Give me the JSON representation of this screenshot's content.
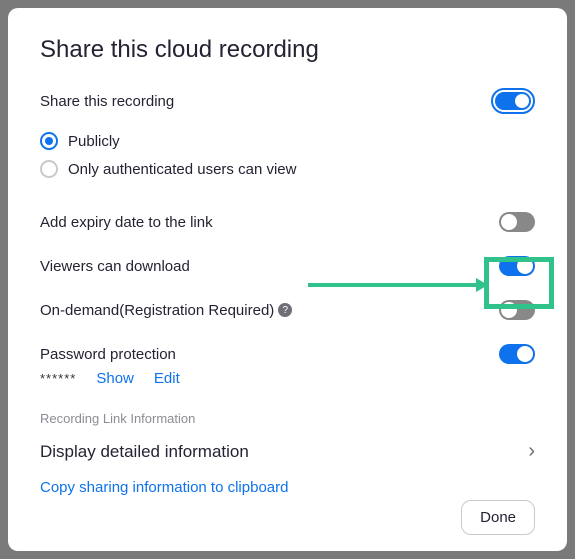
{
  "title": "Share this cloud recording",
  "shareRecording": {
    "label": "Share this recording",
    "options": {
      "publicly": "Publicly",
      "authenticated": "Only authenticated users can view"
    }
  },
  "settings": {
    "expiry": "Add expiry date to the link",
    "download": "Viewers can download",
    "onDemand": "On-demand(Registration Required)",
    "password": "Password protection"
  },
  "password": {
    "masked": "******",
    "show": "Show",
    "edit": "Edit"
  },
  "linkInfo": {
    "header": "Recording Link Information",
    "detail": "Display detailed information",
    "copy": "Copy sharing information to clipboard"
  },
  "done": "Done",
  "helpGlyph": "?"
}
